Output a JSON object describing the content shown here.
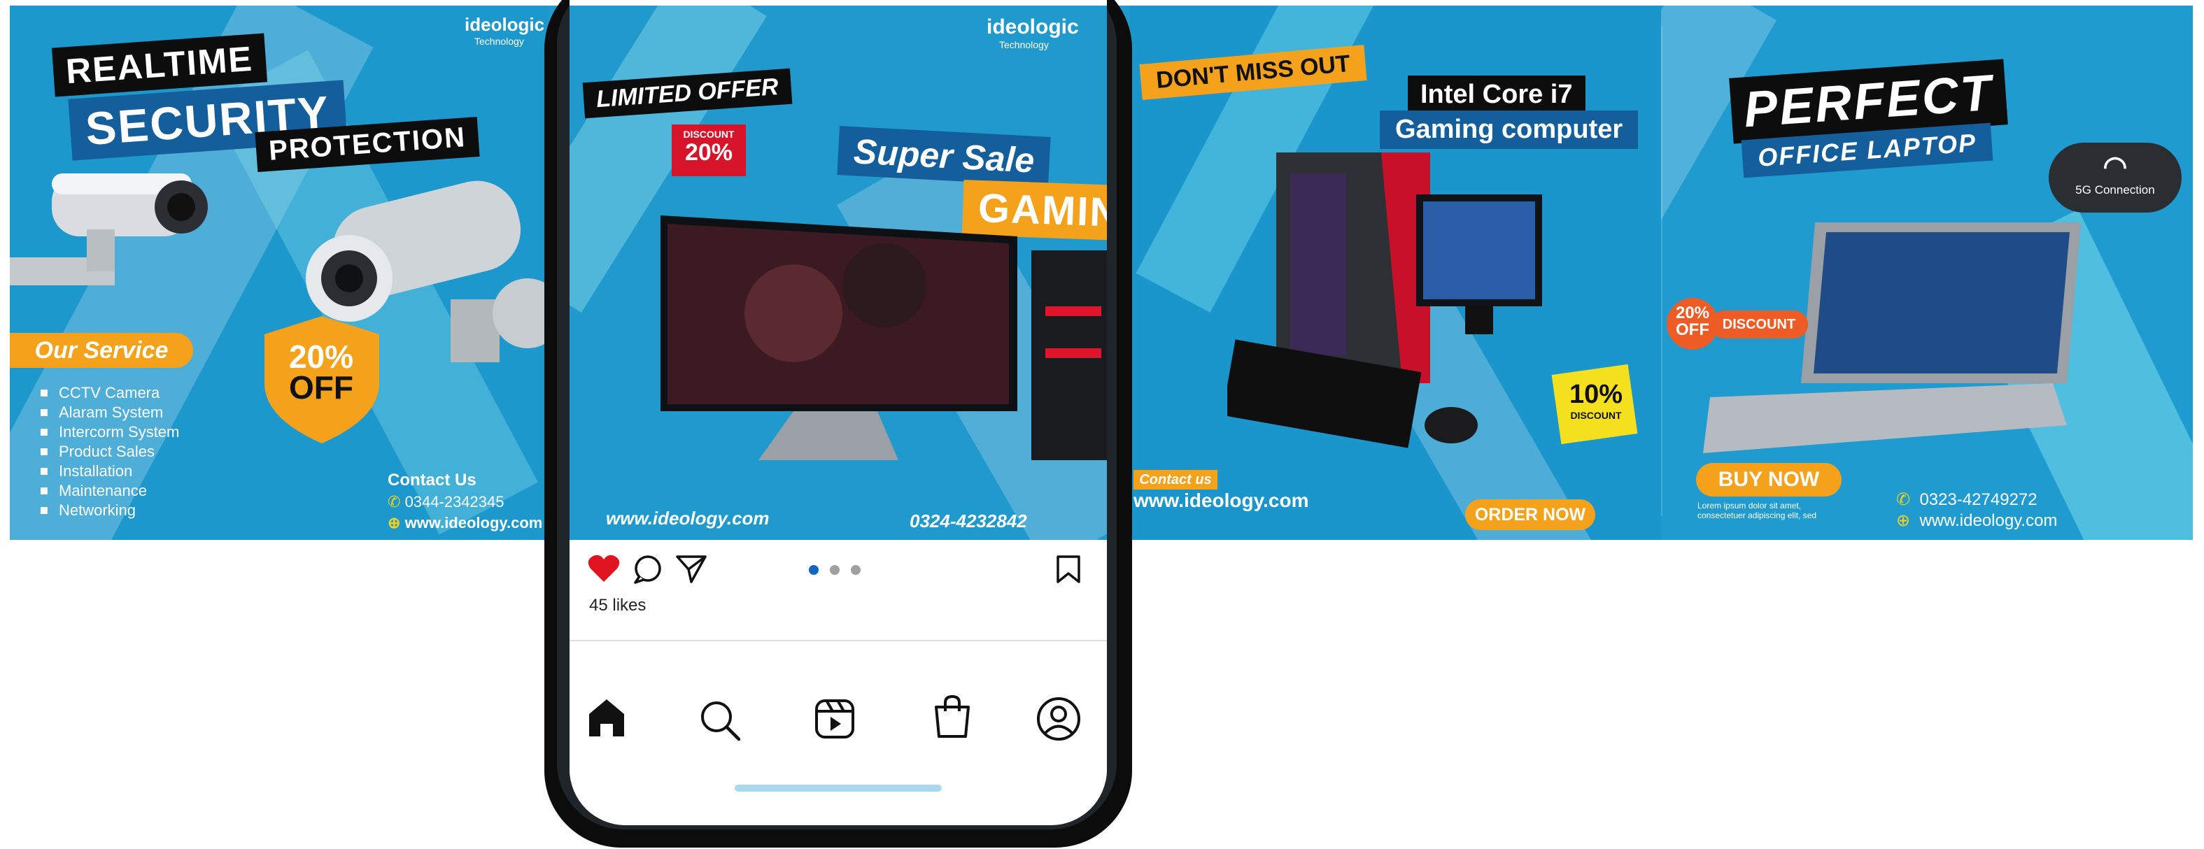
{
  "panel1": {
    "brand": "ideologic",
    "brand_sub": "Technology",
    "title_line1": "REALTIME",
    "title_line2": "SECURITY",
    "title_line3": "PROTECTION",
    "service_heading": "Our Service",
    "services": [
      "CCTV  Camera",
      "Alaram System",
      "Intercorm System",
      "Product Sales",
      "Installation",
      "Maintenance",
      "Networking"
    ],
    "badge_percent": "20%",
    "badge_off": "OFF",
    "contact_heading": "Contact Us",
    "contact_phone": "0344-2342345",
    "contact_web": "www.ideology.com"
  },
  "panel2": {
    "brand": "ideologic",
    "brand_sub": "Technology",
    "limited": "LIMITED OFFER",
    "discount_label": "DISCOUNT",
    "discount_value": "20%",
    "super_sale": "Super Sale",
    "gaming": "GAMING PC",
    "website": "www.ideology.com",
    "phone": "0324-4232842"
  },
  "panel3": {
    "dont_miss": "DON'T MISS OUT",
    "cpu_line1": "Intel Core i7",
    "cpu_line2": "Gaming computer",
    "discount_percent": "10%",
    "discount_label": "DISCOUNT",
    "contact": "Contact us",
    "website": "www.ideology.com",
    "order": "ORDER NOW"
  },
  "panel4": {
    "perfect": "PERFECT",
    "office": "OFFICE LAPTOP",
    "wifi": "5G Connection",
    "off_percent": "20%",
    "off_label": "OFF",
    "discount": "DISCOUNT",
    "buy": "BUY NOW",
    "lorem": "Lorem ipsum dolor sit amet, consectetuer adipiscing elit, sed",
    "phone": "0323-42749272",
    "website": "www.ideology.com"
  },
  "instagram": {
    "likes": "45 likes",
    "icons": [
      "heart-icon",
      "comment-icon",
      "share-icon",
      "bookmark-icon",
      "home-icon",
      "search-icon",
      "reels-icon",
      "shop-icon",
      "profile-icon"
    ]
  },
  "colors": {
    "accent_blue": "#1e9bcf",
    "accent_orange": "#f4a21c",
    "heart_red": "#e0141e",
    "dot_active": "#1565c0"
  }
}
